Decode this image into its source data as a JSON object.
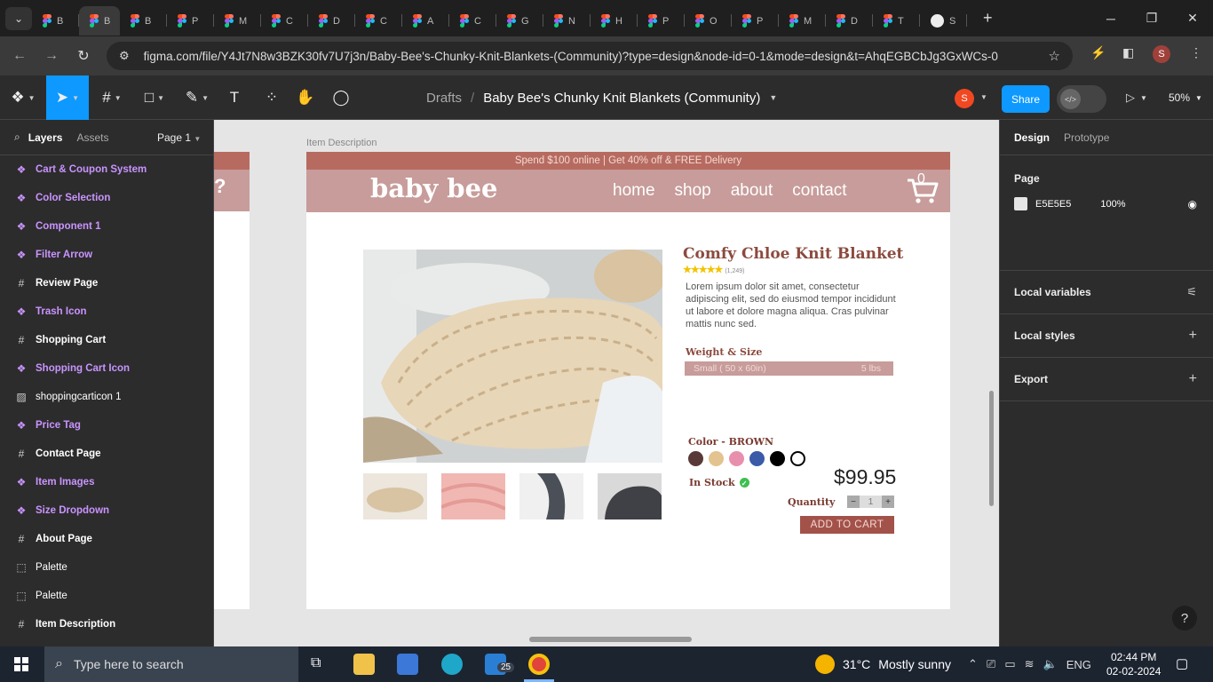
{
  "browser": {
    "tabs": [
      {
        "label": "B",
        "type": "figma"
      },
      {
        "label": "B",
        "type": "figma",
        "active": true
      },
      {
        "label": "B",
        "type": "figma"
      },
      {
        "label": "P",
        "type": "figma"
      },
      {
        "label": "M",
        "type": "figma"
      },
      {
        "label": "C",
        "type": "figma"
      },
      {
        "label": "D",
        "type": "figma"
      },
      {
        "label": "C",
        "type": "figma"
      },
      {
        "label": "A",
        "type": "figma"
      },
      {
        "label": "C",
        "type": "figma"
      },
      {
        "label": "G",
        "type": "figma"
      },
      {
        "label": "N",
        "type": "figma"
      },
      {
        "label": "H",
        "type": "figma"
      },
      {
        "label": "P",
        "type": "figma"
      },
      {
        "label": "O",
        "type": "figma"
      },
      {
        "label": "P",
        "type": "figma"
      },
      {
        "label": "M",
        "type": "figma"
      },
      {
        "label": "D",
        "type": "figma"
      },
      {
        "label": "T",
        "type": "figma"
      },
      {
        "label": "S",
        "type": "github"
      }
    ],
    "url": "figma.com/file/Y4Jt7N8w3BZK30fv7U7j3n/Baby-Bee's-Chunky-Knit-Blankets-(Community)?type=design&node-id=0-1&mode=design&t=AhqEGBCbJg3GxWCs-0",
    "profile_initial": "S"
  },
  "figma": {
    "breadcrumb_root": "Drafts",
    "file_name": "Baby Bee's Chunky Knit Blankets (Community)",
    "user_initial": "S",
    "share_label": "Share",
    "zoom": "50%",
    "left_panel": {
      "tab_layers": "Layers",
      "tab_assets": "Assets",
      "page_selector": "Page 1",
      "layers": [
        {
          "name": "Cart & Coupon System",
          "kind": "component"
        },
        {
          "name": "Color Selection",
          "kind": "component"
        },
        {
          "name": "Component 1",
          "kind": "component"
        },
        {
          "name": "Filter Arrow",
          "kind": "component"
        },
        {
          "name": "Review Page",
          "kind": "frame"
        },
        {
          "name": "Trash Icon",
          "kind": "component"
        },
        {
          "name": "Shopping Cart",
          "kind": "frame"
        },
        {
          "name": "Shopping Cart Icon",
          "kind": "component"
        },
        {
          "name": "shoppingcarticon 1",
          "kind": "image"
        },
        {
          "name": "Price Tag",
          "kind": "component"
        },
        {
          "name": "Contact Page",
          "kind": "frame"
        },
        {
          "name": "Item Images",
          "kind": "component"
        },
        {
          "name": "Size Dropdown",
          "kind": "component"
        },
        {
          "name": "About Page",
          "kind": "frame"
        },
        {
          "name": "Palette",
          "kind": "section"
        },
        {
          "name": "Palette",
          "kind": "section"
        },
        {
          "name": "Item Description",
          "kind": "frame"
        }
      ]
    },
    "right_panel": {
      "tab_design": "Design",
      "tab_prototype": "Prototype",
      "page_section": "Page",
      "page_color": "E5E5E5",
      "page_opacity": "100%",
      "local_variables": "Local variables",
      "local_styles": "Local styles",
      "export": "Export"
    },
    "canvas": {
      "frame_label": "Item Description",
      "side_frame_icon": "?"
    }
  },
  "product_page": {
    "promo": "Spend $100 online | Get 40% off & FREE Delivery",
    "logo": "baby bee",
    "nav": [
      "home",
      "shop",
      "about",
      "contact"
    ],
    "cart_count": "0",
    "title": "Comfy Chloe Knit Blanket",
    "stars": "★★★★★",
    "review_count": "(1,249)",
    "description": "Lorem ipsum dolor sit amet, consectetur adipiscing elit, sed do eiusmod tempor incididunt ut labore et dolore magna aliqua. Cras pulvinar mattis nunc sed.",
    "weight_size_label": "Weight & Size",
    "size_value": "Small ( 50 x 60in)",
    "weight_value": "5 lbs",
    "color_label": "Color - BROWN",
    "swatches": [
      "#5a3a38",
      "#e3c38f",
      "#e98fae",
      "#3b5aa8",
      "#000000",
      "#ffffff"
    ],
    "stock": "In Stock",
    "price": "$99.95",
    "quantity_label": "Quantity",
    "quantity": "1",
    "add_to_cart": "ADD TO CART"
  },
  "taskbar": {
    "search_placeholder": "Type here to search",
    "mail_badge": "25",
    "weather_temp": "31°C",
    "weather_text": "Mostly sunny",
    "lang": "ENG",
    "time": "02:44 PM",
    "date": "02-02-2024"
  }
}
